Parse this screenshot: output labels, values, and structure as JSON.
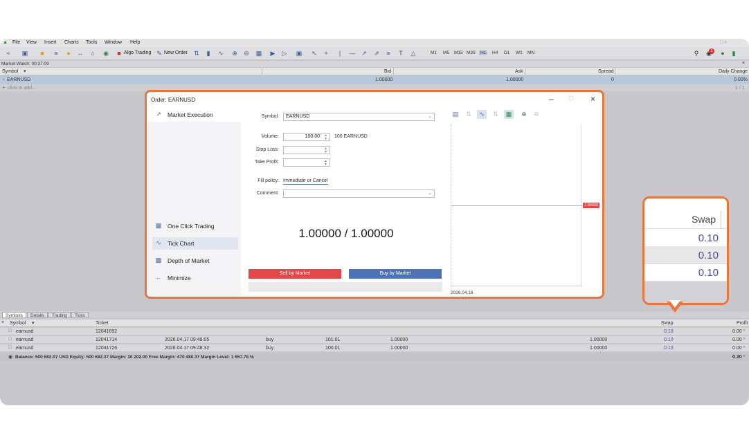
{
  "menu": [
    "File",
    "View",
    "Insert",
    "Charts",
    "Tools",
    "Window",
    "Help"
  ],
  "toolbar": {
    "algo_trading": "Algo Trading",
    "new_order": "New Order",
    "timeframes": [
      "M1",
      "M5",
      "M15",
      "M30",
      "H1",
      "H4",
      "D1",
      "W1",
      "MN"
    ],
    "active_timeframe": "H1",
    "notification_count": "1"
  },
  "market_watch": {
    "title": "Market Watch: 00:37:09",
    "columns": [
      "Symbol",
      "Bid",
      "Ask",
      "Spread",
      "Daily Change"
    ],
    "row": {
      "symbol": "EARNUSD",
      "bid": "1.00000",
      "ask": "1.00000",
      "spread": "0",
      "change": "0.00%"
    },
    "add_text": "click to add...",
    "page_count": "1 / 1"
  },
  "dialog": {
    "title": "Order: EARNUSD",
    "sidebar": {
      "market_execution": "Market Execution",
      "one_click": "One Click Trading",
      "tick_chart": "Tick Chart",
      "depth": "Depth of Market",
      "minimize": "Minimize"
    },
    "form": {
      "symbol_label": "Symbol:",
      "symbol_value": "EARNUSD",
      "volume_label": "Volume:",
      "volume_value": "100.00",
      "volume_note": "100 EARNUSD",
      "stop_loss_label": "Stop Loss:",
      "take_profit_label": "Take Profit:",
      "fill_policy_label": "Fill policy:",
      "fill_policy_value": "Immediate or Cancel",
      "comment_label": "Comment:"
    },
    "price": "1.00000 / 1.00000",
    "sell_label": "Sell by Market",
    "buy_label": "Buy by Market",
    "chart": {
      "price_tag": "1.00000",
      "date": "2026.04.16"
    }
  },
  "terminal": {
    "tabs": [
      "Symbols",
      "Details",
      "Trading",
      "Ticks"
    ],
    "columns": {
      "symbol": "Symbol",
      "ticket": "Ticket",
      "swap": "Swap",
      "profit": "Profit"
    },
    "rows": [
      {
        "symbol": "earnusd",
        "ticket": "12041692",
        "time": "",
        "type": "",
        "volume": "",
        "price": "",
        "cur": "",
        "swap": "0.10",
        "profit": "0.00"
      },
      {
        "symbol": "earnusd",
        "ticket": "12041714",
        "time": "2026.04.17 09:48:05",
        "type": "buy",
        "volume": "101.01",
        "price": "1.00000",
        "cur": "1.00000",
        "swap": "0.10",
        "profit": "0.00"
      },
      {
        "symbol": "earnusd",
        "ticket": "12041726",
        "time": "2026.04.17 09:48:32",
        "type": "buy",
        "volume": "100.01",
        "price": "1.00000",
        "cur": "1.00000",
        "swap": "0.10",
        "profit": "0.00"
      }
    ],
    "balance_line": "Balance: 500 682.07 USD  Equity: 500 682.37  Margin: 30 202.00  Free Margin: 470 480.37  Margin Level: 1 657.78 %",
    "balance_total": "0.30"
  },
  "callout": {
    "header": "Swap",
    "values": [
      "0.10",
      "0.10",
      "0.10"
    ]
  },
  "colors": {
    "highlight_border": "#e8763a",
    "sell": "#e34848",
    "buy": "#4d73b6",
    "swap_value": "#4a4aa8"
  }
}
